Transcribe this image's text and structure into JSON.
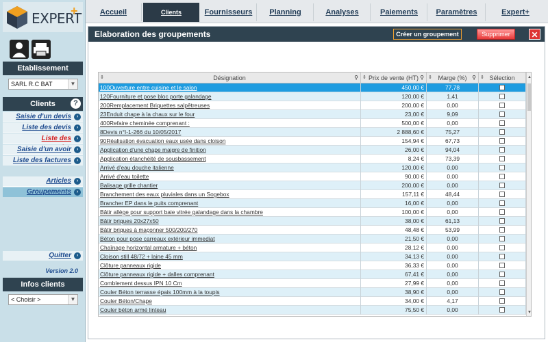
{
  "app": {
    "brand": "EXPERT",
    "brand_plus": "+"
  },
  "topnav": [
    {
      "label": "Accueil",
      "active": false
    },
    {
      "label": "Clients",
      "active": true
    },
    {
      "label": "Fournisseurs",
      "active": false
    },
    {
      "label": "Planning",
      "active": false
    },
    {
      "label": "Analyses",
      "active": false
    },
    {
      "label": "Paiements",
      "active": false
    },
    {
      "label": "Paramètres",
      "active": false
    },
    {
      "label": "Expert+",
      "active": false
    }
  ],
  "sidebar": {
    "etablissement_title": "Etablissement",
    "etablissement_value": "SARL R.C BAT",
    "clients_title": "Clients",
    "help_label": "?",
    "items": [
      {
        "label": "Saisie d'un devis",
        "red": false,
        "active": false
      },
      {
        "label": "Liste des devis",
        "red": false,
        "active": false
      },
      {
        "label": "Liste des commandes",
        "red": true,
        "active": false
      },
      {
        "label": "Saisie d'un avoir",
        "red": false,
        "active": false
      },
      {
        "label": "Liste des factures",
        "red": false,
        "active": false
      }
    ],
    "items2": [
      {
        "label": "Articles",
        "active": false
      },
      {
        "label": "Groupements",
        "active": true
      }
    ],
    "quit_label": "Quitter",
    "version": "Version 2.0",
    "infos_title": "Infos clients",
    "infos_select": "< Choisir >"
  },
  "main": {
    "title": "Elaboration des groupements",
    "create_label": "Créer un groupement",
    "delete_label": "Supprimer",
    "close_label": "✕"
  },
  "table": {
    "headers": {
      "designation": "Désignation",
      "prix": "Prix de vente (HT)",
      "marge": "Marge (%)",
      "selection": "Sélection"
    },
    "rows": [
      {
        "d": "100Ouverture entre cuisine et le salon",
        "p": "450,00 €",
        "m": "77,78"
      },
      {
        "d": "120Fourniture et pose bloc porte galandage",
        "p": "120,00 €",
        "m": "1,41"
      },
      {
        "d": "200Remplacement Briquettes salpêtreuses",
        "p": "200,00 €",
        "m": "0,00"
      },
      {
        "d": "23Enduit chape à la chaux sur le four",
        "p": "23,00 €",
        "m": "9,09"
      },
      {
        "d": "400Refaire cheminée comprenant :",
        "p": "500,00 €",
        "m": "0,00"
      },
      {
        "d": "8Devis n°I-1-266 du 10/05/2017",
        "p": "2 888,60 €",
        "m": "75,27"
      },
      {
        "d": "90Réalisation évacuation eaux usée dans cloison",
        "p": "154,94 €",
        "m": "67,73"
      },
      {
        "d": "Application d'une chape maigre de finition",
        "p": "26,00 €",
        "m": "94,04"
      },
      {
        "d": "Application étanchéité de sousbassement",
        "p": "8,24 €",
        "m": "73,39"
      },
      {
        "d": "Arrivé d'eau douche italienne",
        "p": "120,00 €",
        "m": "0,00"
      },
      {
        "d": "Arrivé d'eau toilette",
        "p": "90,00 €",
        "m": "0,00"
      },
      {
        "d": "Balisage grille chantier",
        "p": "200,00 €",
        "m": "0,00"
      },
      {
        "d": "Branchement des eaux pluviales dans un Sogebox",
        "p": "157,11 €",
        "m": "48,44"
      },
      {
        "d": "Brancher EP dans le puits comprenant",
        "p": "16,00 €",
        "m": "0,00"
      },
      {
        "d": "Bâtir allège pour support baie vitrée galandage dans la chambre",
        "p": "100,00 €",
        "m": "0,00"
      },
      {
        "d": "Bâtir briques 20x27x50",
        "p": "38,00 €",
        "m": "61,13"
      },
      {
        "d": "Bâtir briques à maçonner 500/200/270",
        "p": "48,48 €",
        "m": "53,99"
      },
      {
        "d": "Béton pour pose carreaux extérieur immediat",
        "p": "21,50 €",
        "m": "0,00"
      },
      {
        "d": "Chaînage horizontal armature + béton",
        "p": "28,12 €",
        "m": "0,00"
      },
      {
        "d": "Cloison still 48/72 + laine 45 mm",
        "p": "34,13 €",
        "m": "0,00"
      },
      {
        "d": "Clôture panneaux rigide",
        "p": "36,33 €",
        "m": "0,00"
      },
      {
        "d": "Clôture panneaux rigide + dalles comprenant",
        "p": "67,41 €",
        "m": "0,00"
      },
      {
        "d": "Comblement dessus IPN 10 Cm",
        "p": "27,99 €",
        "m": "0,00"
      },
      {
        "d": "Couler Béton terrasse épais 100mm à la toupis",
        "p": "38,90 €",
        "m": "0,00"
      },
      {
        "d": "Couler Béton/Chape",
        "p": "34,00 €",
        "m": "4,17"
      },
      {
        "d": "Couler béton armé linteau",
        "p": "75,50 €",
        "m": "0,00"
      }
    ]
  }
}
